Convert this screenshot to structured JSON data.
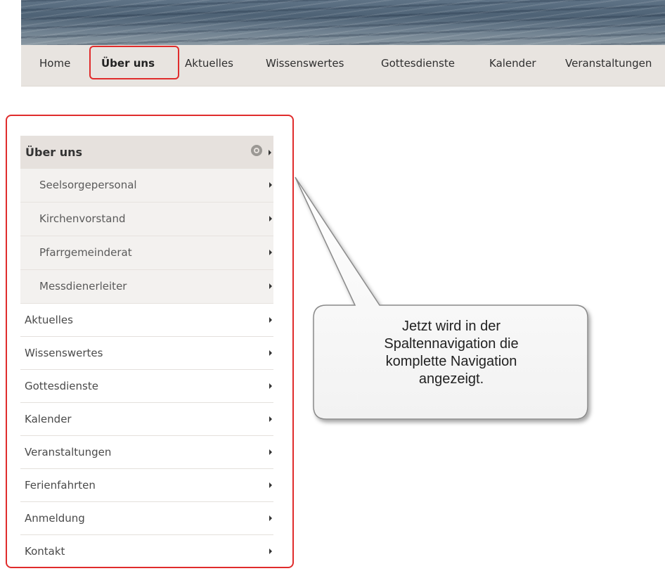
{
  "topnav": {
    "items": [
      "Home",
      "Über uns",
      "Aktuelles",
      "Wissenswertes",
      "Gottesdienste",
      "Kalender",
      "Veranstaltungen"
    ],
    "active_index": 1
  },
  "sidenav": {
    "header": "Über uns",
    "subitems": [
      "Seelsorgepersonal",
      "Kirchenvorstand",
      "Pfarrgemeinderat",
      "Messdienerleiter"
    ],
    "items": [
      "Aktuelles",
      "Wissenswertes",
      "Gottesdienste",
      "Kalender",
      "Veranstaltungen",
      "Ferienfahrten",
      "Anmeldung",
      "Kontakt"
    ]
  },
  "callout": {
    "lines": [
      "Jetzt wird in der",
      "Spaltennavigation die",
      "komplette Navigation",
      "angezeigt."
    ]
  },
  "colors": {
    "highlight": "#e02c2c",
    "nav_background": "#e8e4e0",
    "header_background": "#e6e1dd"
  }
}
